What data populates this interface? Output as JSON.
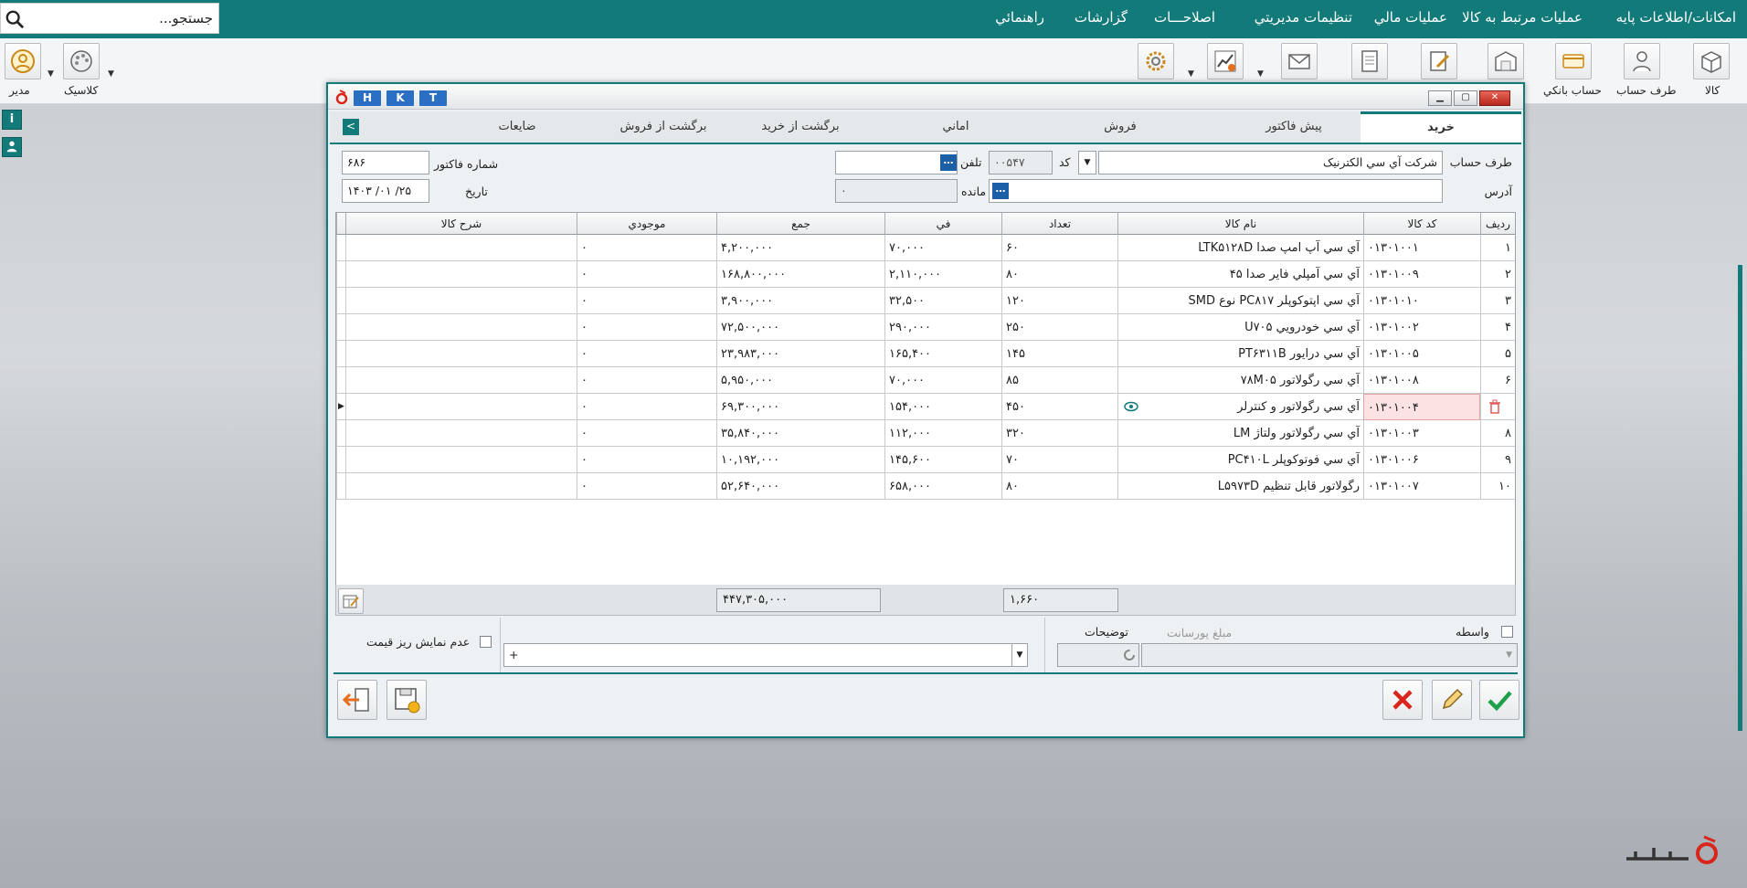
{
  "search": {
    "placeholder": "جستجو..."
  },
  "menu": [
    "امکانات/اطلاعات پايه",
    "عمليات مرتبط به کالا",
    "عمليات مالي",
    "تنظيمات مديريتي",
    "اصلاحـــات",
    "گزارشات",
    "راهنمائي"
  ],
  "toolbar": {
    "kala": "کالا",
    "taraf_hesab": "طرف حساب",
    "hesab_banki": "حساب بانکي",
    "classic": "کلاسيک",
    "modir": "مدير"
  },
  "dialog": {
    "hk_buttons": [
      "H",
      "K",
      "T"
    ],
    "tabs": [
      "خريد",
      "پيش فاکتور",
      "فروش",
      "اماني",
      "برگشت از خريد",
      "برگشت از فروش",
      "ضايعات"
    ],
    "form": {
      "taraf_hesab_label": "طرف حساب",
      "taraf_hesab_value": "شرکت آي سي الکترنيک",
      "code_label": "کد",
      "code_value": "۰۰۵۴۷",
      "phone_label": "تلفن",
      "phone_value": "",
      "address_label": "آدرس",
      "address_value": "",
      "mande_label": "مانده",
      "mande_value": "۰",
      "invoice_no_label": "شماره فاکتور",
      "invoice_no_value": "۶۸۶",
      "date_label": "تاريخ",
      "date_value": "۱۴۰۳ /۰۱ /۲۵"
    },
    "grid": {
      "headers": {
        "radif": "رديف",
        "code": "کد کالا",
        "name": "نام کالا",
        "qty": "تعداد",
        "price": "في",
        "total": "جمع",
        "stock": "موجودي",
        "desc": "شرح کالا"
      },
      "rows": [
        {
          "radif": "۱",
          "code": "۰۱۳۰۱۰۰۱",
          "name": "آي سي آپ امپ صدا LTK۵۱۲۸D",
          "qty": "۶۰",
          "price": "۷۰,۰۰۰",
          "total": "۴,۲۰۰,۰۰۰",
          "stock": "۰",
          "desc": ""
        },
        {
          "radif": "۲",
          "code": "۰۱۳۰۱۰۰۹",
          "name": "آي سي آمپلي فاير صدا ۴۵",
          "qty": "۸۰",
          "price": "۲,۱۱۰,۰۰۰",
          "total": "۱۶۸,۸۰۰,۰۰۰",
          "stock": "۰",
          "desc": ""
        },
        {
          "radif": "۳",
          "code": "۰۱۳۰۱۰۱۰",
          "name": "آي سي اپتوکوپلر PC۸۱۷ نوع SMD",
          "qty": "۱۲۰",
          "price": "۳۲,۵۰۰",
          "total": "۳,۹۰۰,۰۰۰",
          "stock": "۰",
          "desc": ""
        },
        {
          "radif": "۴",
          "code": "۰۱۳۰۱۰۰۲",
          "name": "آي سي خودرويي U۷۰۵",
          "qty": "۲۵۰",
          "price": "۲۹۰,۰۰۰",
          "total": "۷۲,۵۰۰,۰۰۰",
          "stock": "۰",
          "desc": ""
        },
        {
          "radif": "۵",
          "code": "۰۱۳۰۱۰۰۵",
          "name": "آي سي درايور PT۶۳۱۱B",
          "qty": "۱۴۵",
          "price": "۱۶۵,۴۰۰",
          "total": "۲۳,۹۸۳,۰۰۰",
          "stock": "۰",
          "desc": ""
        },
        {
          "radif": "۶",
          "code": "۰۱۳۰۱۰۰۸",
          "name": "آي سي رگولاتور ۷۸M۰۵",
          "qty": "۸۵",
          "price": "۷۰,۰۰۰",
          "total": "۵,۹۵۰,۰۰۰",
          "stock": "۰",
          "desc": ""
        },
        {
          "radif": "",
          "code": "۰۱۳۰۱۰۰۴",
          "name": "آي سي رگولاتور و کنترلر",
          "qty": "۴۵۰",
          "price": "۱۵۴,۰۰۰",
          "total": "۶۹,۳۰۰,۰۰۰",
          "stock": "۰",
          "desc": ""
        },
        {
          "radif": "۸",
          "code": "۰۱۳۰۱۰۰۳",
          "name": "آي سي رگولاتور ولتاژ LM",
          "qty": "۳۲۰",
          "price": "۱۱۲,۰۰۰",
          "total": "۳۵,۸۴۰,۰۰۰",
          "stock": "۰",
          "desc": ""
        },
        {
          "radif": "۹",
          "code": "۰۱۳۰۱۰۰۶",
          "name": "آي سي فوتوکوپلر PC۴۱۰L",
          "qty": "۷۰",
          "price": "۱۴۵,۶۰۰",
          "total": "۱۰,۱۹۲,۰۰۰",
          "stock": "۰",
          "desc": ""
        },
        {
          "radif": "۱۰",
          "code": "۰۱۳۰۱۰۰۷",
          "name": "رگولاتور قابل تنظيم L۵۹۷۳D",
          "qty": "۸۰",
          "price": "۶۵۸,۰۰۰",
          "total": "۵۲,۶۴۰,۰۰۰",
          "stock": "۰",
          "desc": ""
        }
      ],
      "active_row": 6
    },
    "totals": {
      "qty": "۱,۶۶۰",
      "total": "۴۴۷,۳۰۵,۰۰۰"
    },
    "bottom": {
      "vaseteh_label": "واسطه",
      "porsant_label": "مبلغ پورسانت",
      "tozihat_label": "توضيحات",
      "tozihat_value": "+",
      "hide_price_label": "عدم نمايش ريز قيمت"
    }
  },
  "colors": {
    "accent": "#137a7a",
    "tab_blue": "#2a6fc4",
    "danger": "#d9261c",
    "ok": "#1fa04a"
  }
}
